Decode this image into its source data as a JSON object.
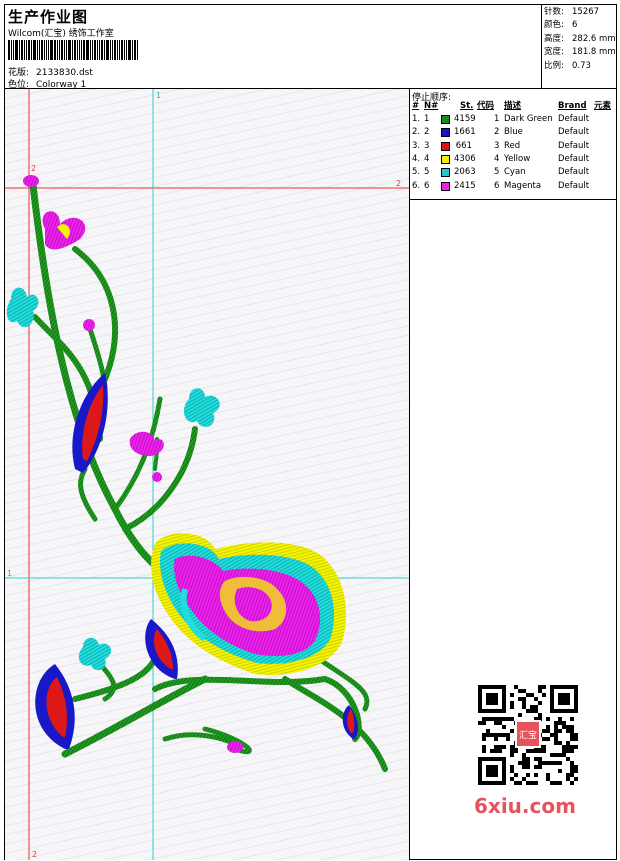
{
  "header": {
    "title": "生产作业图",
    "company": "Wilcom(汇宝) 绣饰工作室",
    "design_label": "花版:",
    "design_value": "2133830.dst",
    "colorway_label": "色位:",
    "colorway_value": "Colorway 1"
  },
  "stats": [
    {
      "label": "针数:",
      "value": "15267"
    },
    {
      "label": "颜色:",
      "value": "6"
    },
    {
      "label": "高度:",
      "value": "282.6 mm"
    },
    {
      "label": "宽度:",
      "value": "181.8 mm"
    },
    {
      "label": "比例:",
      "value": "0.73"
    }
  ],
  "guides": {
    "top_marker": "1",
    "left_marker": "1",
    "red_right_marker": "2",
    "red_top_marker": "2",
    "bottom_marker": "2"
  },
  "stop_sequence": {
    "title": "停止顺序:",
    "columns": {
      "num": "#",
      "needle": "N#",
      "stitches": "St.",
      "code": "代码",
      "description": "描述",
      "brand": "Brand",
      "element": "元素"
    },
    "rows": [
      {
        "num": "1.",
        "needle": "1",
        "color": "#1a8a1a",
        "stitches": "4159",
        "code": "1",
        "description": "Dark Green",
        "brand": "Default"
      },
      {
        "num": "2.",
        "needle": "2",
        "color": "#1414d2",
        "stitches": "1661",
        "code": "2",
        "description": "Blue",
        "brand": "Default"
      },
      {
        "num": "3.",
        "needle": "3",
        "color": "#e01414",
        "stitches": "661",
        "code": "3",
        "description": "Red",
        "brand": "Default"
      },
      {
        "num": "4.",
        "needle": "4",
        "color": "#f0f000",
        "stitches": "4306",
        "code": "4",
        "description": "Yellow",
        "brand": "Default"
      },
      {
        "num": "5.",
        "needle": "5",
        "color": "#1ec8c8",
        "stitches": "2063",
        "code": "5",
        "description": "Cyan",
        "brand": "Default"
      },
      {
        "num": "6.",
        "needle": "6",
        "color": "#f01ef0",
        "stitches": "2415",
        "code": "6",
        "description": "Magenta",
        "brand": "Default"
      }
    ]
  },
  "qr_badge": "汇宝",
  "watermark": "6xiu.com",
  "colors": {
    "green": "#229922",
    "blue": "#1818c8",
    "red": "#dd1818",
    "yellow": "#f4f400",
    "cyan": "#22dddd",
    "magenta": "#ee22ee",
    "guide_red": "#ee3333",
    "guide_cyan": "#33cccc"
  }
}
